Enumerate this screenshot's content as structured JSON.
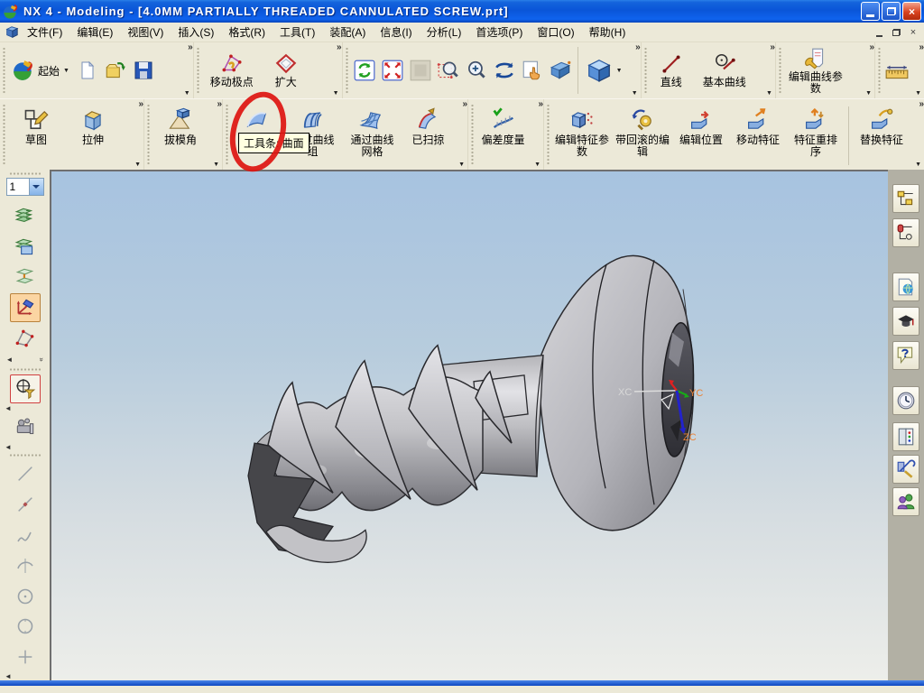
{
  "window": {
    "title": "NX 4 - Modeling - [4.0MM PARTIALLY THREADED CANNULATED SCREW.prt]"
  },
  "glyphs": {
    "overflow": "»",
    "dropdown": "▼",
    "collapse_left": "◄",
    "collapse_down": "»",
    "close": "×"
  },
  "menu": {
    "items": [
      {
        "label": "文件(F)"
      },
      {
        "label": "编辑(E)"
      },
      {
        "label": "视图(V)"
      },
      {
        "label": "插入(S)"
      },
      {
        "label": "格式(R)"
      },
      {
        "label": "工具(T)"
      },
      {
        "label": "装配(A)"
      },
      {
        "label": "信息(I)"
      },
      {
        "label": "分析(L)"
      },
      {
        "label": "首选项(P)"
      },
      {
        "label": "窗口(O)"
      },
      {
        "label": "帮助(H)"
      }
    ]
  },
  "toolbars": {
    "row1": {
      "start_label": "起始",
      "move_pole": "移动极点",
      "enlarge": "扩大",
      "line": "直线",
      "basic_curves": "基本曲线",
      "edit_curve_params": "编辑曲线参数"
    },
    "row2": {
      "sketch": "草图",
      "extrude": "拉伸",
      "draft_angle": "拔模角",
      "ruled": "直纹",
      "through_curve_group": "通过曲线组",
      "through_curve_mesh": "通过曲线网格",
      "swept": "已扫掠",
      "deviation": "偏差度量",
      "edit_feature_params": "编辑特征参数",
      "edit_with_rollback": "带回滚的编辑",
      "edit_position": "编辑位置",
      "move_feature": "移动特征",
      "feature_reorder": "特征重排序",
      "replace_feature": "替换特征"
    }
  },
  "tooltip": {
    "text": "工具条: 曲面"
  },
  "annotation": {
    "type": "hand-drawn red ellipse circling the Surface toolbar area",
    "color": "#dd1410"
  },
  "left_sidebar": {
    "layer_selector_value": "1"
  },
  "viewport": {
    "model": "4.0MM partially threaded cannulated screw (gray shaded 3D model, head right, threads left)",
    "triad": {
      "x": "XC",
      "y": "YC",
      "z": "ZC"
    }
  },
  "colors": {
    "titlebar_blue": "#0a55d8",
    "toolbar_bg": "#ece9d8",
    "viewport_top": "#a7c3e0",
    "viewport_bottom": "#edeeea",
    "annotation_red": "#dd1410",
    "triad_label_orange": "#e8833a"
  }
}
